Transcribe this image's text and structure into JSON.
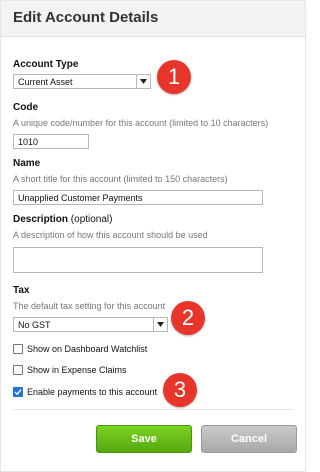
{
  "dialog": {
    "title": "Edit Account Details"
  },
  "account_type": {
    "label": "Account Type",
    "value": "Current Asset"
  },
  "code": {
    "label": "Code",
    "hint": "A unique code/number for this account (limited to 10 characters)",
    "value": "1010"
  },
  "name": {
    "label": "Name",
    "hint": "A short title for this account (limited to 150 characters)",
    "value": "Unapplied Customer Payments"
  },
  "description": {
    "label": "Description",
    "label_suffix": "(optional)",
    "hint": "A description of how this account should be used",
    "value": ""
  },
  "tax": {
    "label": "Tax",
    "hint": "The default tax setting for this account",
    "value": "No GST"
  },
  "checkboxes": {
    "watchlist": {
      "label": "Show on Dashboard Watchlist",
      "checked": false
    },
    "expense": {
      "label": "Show in Expense Claims",
      "checked": false
    },
    "payments": {
      "label": "Enable payments to this account",
      "checked": true
    }
  },
  "badges": [
    "1",
    "2",
    "3"
  ],
  "buttons": {
    "save": "Save",
    "cancel": "Cancel"
  },
  "colors": {
    "badge": "#e8352b",
    "save": "#62b918",
    "cancel": "#b5b5b5",
    "checkbox_checked": "#1e73d6"
  }
}
